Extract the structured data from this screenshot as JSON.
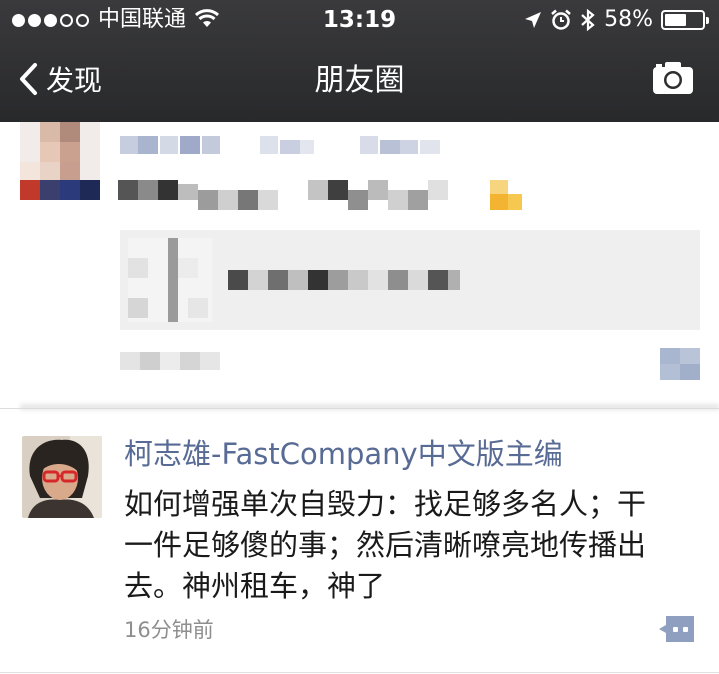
{
  "status_bar": {
    "carrier": "中国联通",
    "time": "13:19",
    "battery_percent": "58%",
    "battery_level": 0.58,
    "signal_bars": 3,
    "signal_total": 5,
    "icons": [
      "wifi-icon",
      "location-arrow-icon",
      "alarm-icon",
      "bluetooth-icon",
      "battery-icon"
    ]
  },
  "nav": {
    "back_label": "发现",
    "title": "朋友圈",
    "right_icon": "camera-icon"
  },
  "posts": [
    {
      "blurred": true
    },
    {
      "author": "柯志雄-FastCompany中文版主编",
      "content_lines": [
        "如何增强单次自毁力：找足够多名人；干",
        "一件足够傻的事；然后清晰嘹亮地传播出",
        "去。神州租车，神了"
      ],
      "time": "16分钟前",
      "comment_icon": "comment-bubble-icon"
    }
  ],
  "colors": {
    "nav_bg": "#2d2e30",
    "author_link": "#586b95",
    "timestamp": "#8e8e8e",
    "comment_button": "#8f9fbf"
  }
}
